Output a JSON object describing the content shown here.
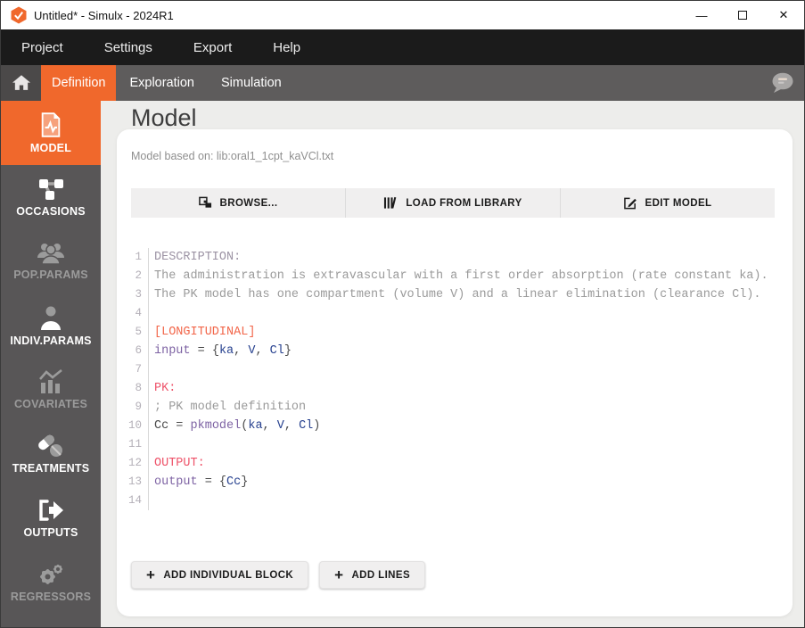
{
  "titlebar": {
    "title": "Untitled* - Simulx - 2024R1",
    "minimize_glyph": "—",
    "maximize_glyph": "",
    "close_glyph": "✕"
  },
  "menubar": {
    "items": [
      "Project",
      "Settings",
      "Export",
      "Help"
    ]
  },
  "tabbar": {
    "tabs": [
      {
        "label": "Definition",
        "active": true
      },
      {
        "label": "Exploration",
        "active": false
      },
      {
        "label": "Simulation",
        "active": false
      }
    ]
  },
  "sidebar": {
    "items": [
      {
        "label": "MODEL",
        "icon": "model-file-icon",
        "state": "active"
      },
      {
        "label": "OCCASIONS",
        "icon": "occasions-nodes-icon",
        "state": "enabled"
      },
      {
        "label": "POP.PARAMS",
        "icon": "population-people-icon",
        "state": "disabled"
      },
      {
        "label": "INDIV.PARAMS",
        "icon": "individual-person-icon",
        "state": "enabled"
      },
      {
        "label": "COVARIATES",
        "icon": "covariates-chart-icon",
        "state": "disabled"
      },
      {
        "label": "TREATMENTS",
        "icon": "treatments-pills-icon",
        "state": "enabled"
      },
      {
        "label": "OUTPUTS",
        "icon": "outputs-export-icon",
        "state": "enabled"
      },
      {
        "label": "REGRESSORS",
        "icon": "regressors-gears-icon",
        "state": "disabled"
      }
    ]
  },
  "main": {
    "page_title": "Model",
    "model_based_on": "Model based on: lib:oral1_1cpt_kaVCl.txt",
    "toolbar": {
      "browse_label": "BROWSE...",
      "load_library_label": "LOAD FROM LIBRARY",
      "edit_model_label": "EDIT MODEL"
    },
    "actions": {
      "plus_glyph": "+",
      "add_individual_block_label": "ADD INDIVIDUAL BLOCK",
      "add_lines_label": "ADD LINES"
    }
  },
  "editor": {
    "lines": [
      {
        "n": 1,
        "tokens": [
          {
            "text": "DESCRIPTION:",
            "style": "desc"
          }
        ]
      },
      {
        "n": 2,
        "tokens": [
          {
            "text": "The administration is extravascular with a first order absorption (rate constant ka).",
            "style": "gray"
          }
        ]
      },
      {
        "n": 3,
        "tokens": [
          {
            "text": "The PK model has one compartment (volume V) and a linear elimination (clearance Cl).",
            "style": "gray"
          }
        ]
      },
      {
        "n": 4,
        "tokens": []
      },
      {
        "n": 5,
        "tokens": [
          {
            "text": "[LONGITUDINAL]",
            "style": "orange"
          }
        ]
      },
      {
        "n": 6,
        "tokens": [
          {
            "text": "input",
            "style": "purple"
          },
          {
            "text": " = ",
            "style": "plain"
          },
          {
            "text": "{",
            "style": "plain"
          },
          {
            "text": "ka",
            "style": "blue"
          },
          {
            "text": ", ",
            "style": "plain"
          },
          {
            "text": "V",
            "style": "blue"
          },
          {
            "text": ", ",
            "style": "plain"
          },
          {
            "text": "Cl",
            "style": "blue"
          },
          {
            "text": "}",
            "style": "plain"
          }
        ]
      },
      {
        "n": 7,
        "tokens": []
      },
      {
        "n": 8,
        "tokens": [
          {
            "text": "PK:",
            "style": "red"
          }
        ]
      },
      {
        "n": 9,
        "tokens": [
          {
            "text": "; PK model definition",
            "style": "gray"
          }
        ]
      },
      {
        "n": 10,
        "tokens": [
          {
            "text": "Cc",
            "style": "plain"
          },
          {
            "text": " = ",
            "style": "plain"
          },
          {
            "text": "pkmodel",
            "style": "purple"
          },
          {
            "text": "(",
            "style": "plain"
          },
          {
            "text": "ka",
            "style": "blue"
          },
          {
            "text": ", ",
            "style": "plain"
          },
          {
            "text": "V",
            "style": "blue"
          },
          {
            "text": ", ",
            "style": "plain"
          },
          {
            "text": "Cl",
            "style": "blue"
          },
          {
            "text": ")",
            "style": "plain"
          }
        ]
      },
      {
        "n": 11,
        "tokens": []
      },
      {
        "n": 12,
        "tokens": [
          {
            "text": "OUTPUT:",
            "style": "red"
          }
        ]
      },
      {
        "n": 13,
        "tokens": [
          {
            "text": "output",
            "style": "purple"
          },
          {
            "text": " = ",
            "style": "plain"
          },
          {
            "text": "{",
            "style": "plain"
          },
          {
            "text": "Cc",
            "style": "blue"
          },
          {
            "text": "}",
            "style": "plain"
          }
        ]
      },
      {
        "n": 14,
        "tokens": []
      }
    ]
  },
  "colors": {
    "accent_orange": "#f0682c",
    "sidebar_gray": "#585657",
    "menubar_black": "#1b1b1b",
    "section_red": "#ee5168",
    "longitudinal_orange": "#f2664a",
    "keyword_purple": "#7d62a3",
    "param_blue": "#27418f",
    "comment_gray": "#9a9a9a"
  }
}
